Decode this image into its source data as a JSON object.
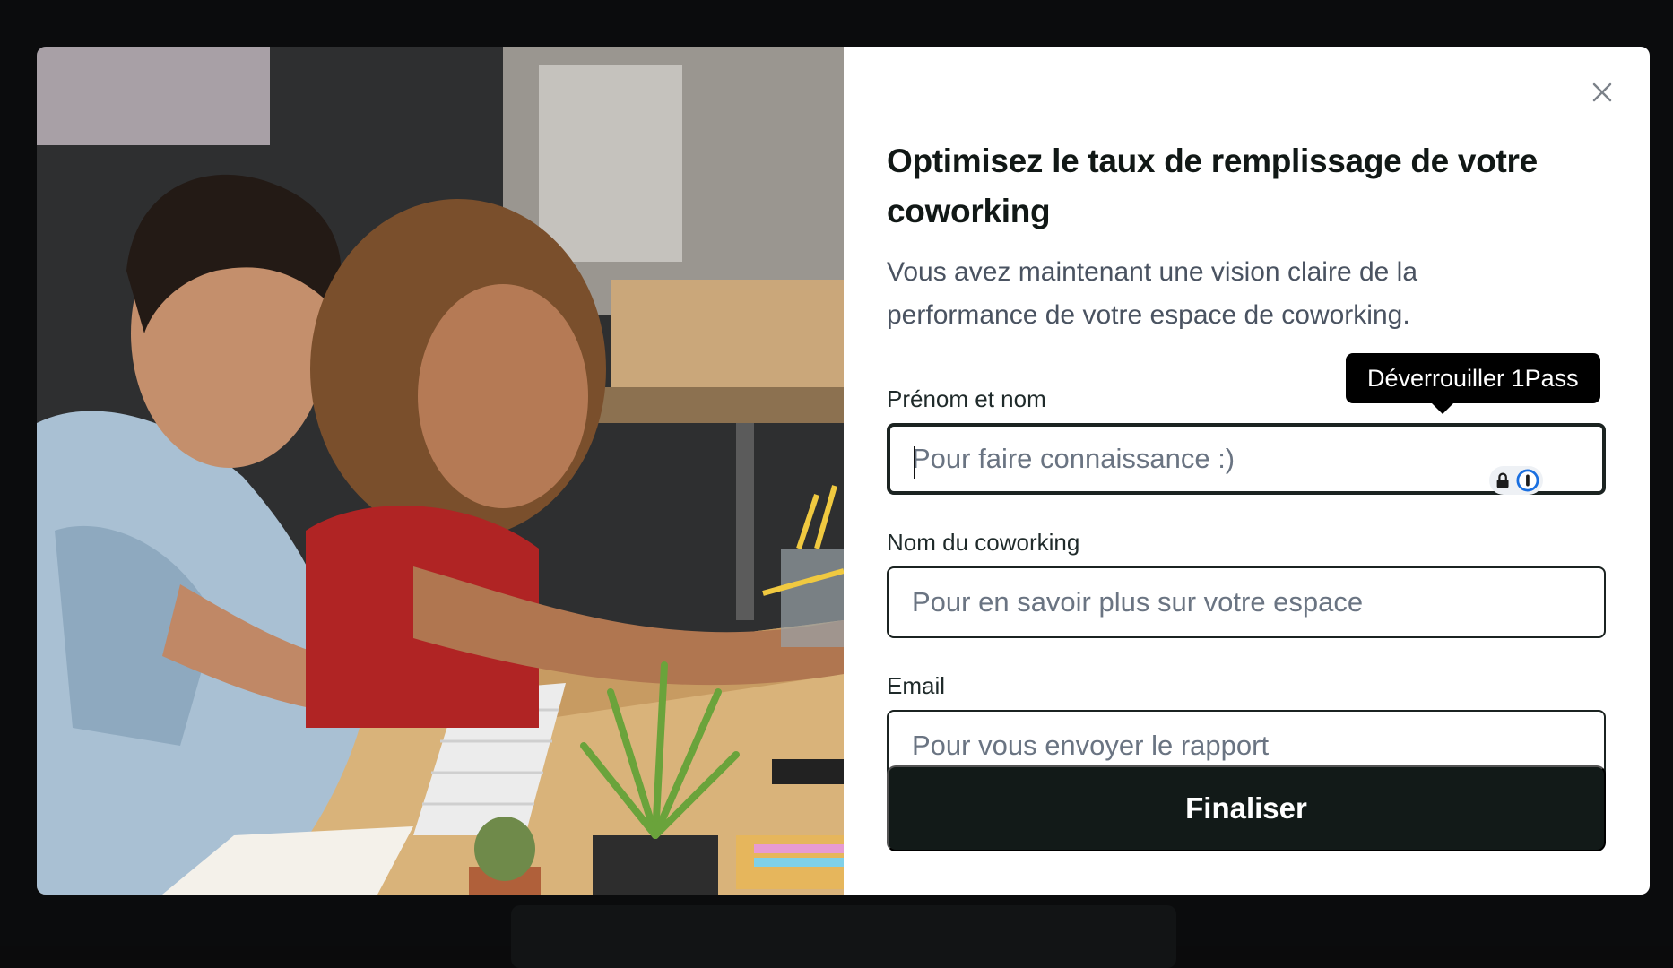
{
  "modal": {
    "title": "Optimisez le taux de remplissage de votre coworking",
    "subtitle": "Vous avez maintenant une vision claire de la performance de votre espace de coworking.",
    "close_icon": "close-icon"
  },
  "fields": [
    {
      "label": "Prénom et nom",
      "placeholder": "Pour faire connaissance :)",
      "value": ""
    },
    {
      "label": "Nom du coworking",
      "placeholder": "Pour en savoir plus sur votre espace",
      "value": ""
    },
    {
      "label": "Email",
      "placeholder": "Pour vous envoyer le rapport",
      "value": ""
    }
  ],
  "password_manager": {
    "tooltip": "Déverrouiller 1Pass",
    "icons": [
      "lock-icon",
      "onepassword-icon"
    ]
  },
  "submit": {
    "label": "Finaliser"
  },
  "colors": {
    "primary_button": "#121a18",
    "text_dark": "#111816",
    "text_muted": "#4a5361",
    "placeholder": "#6a7482"
  }
}
